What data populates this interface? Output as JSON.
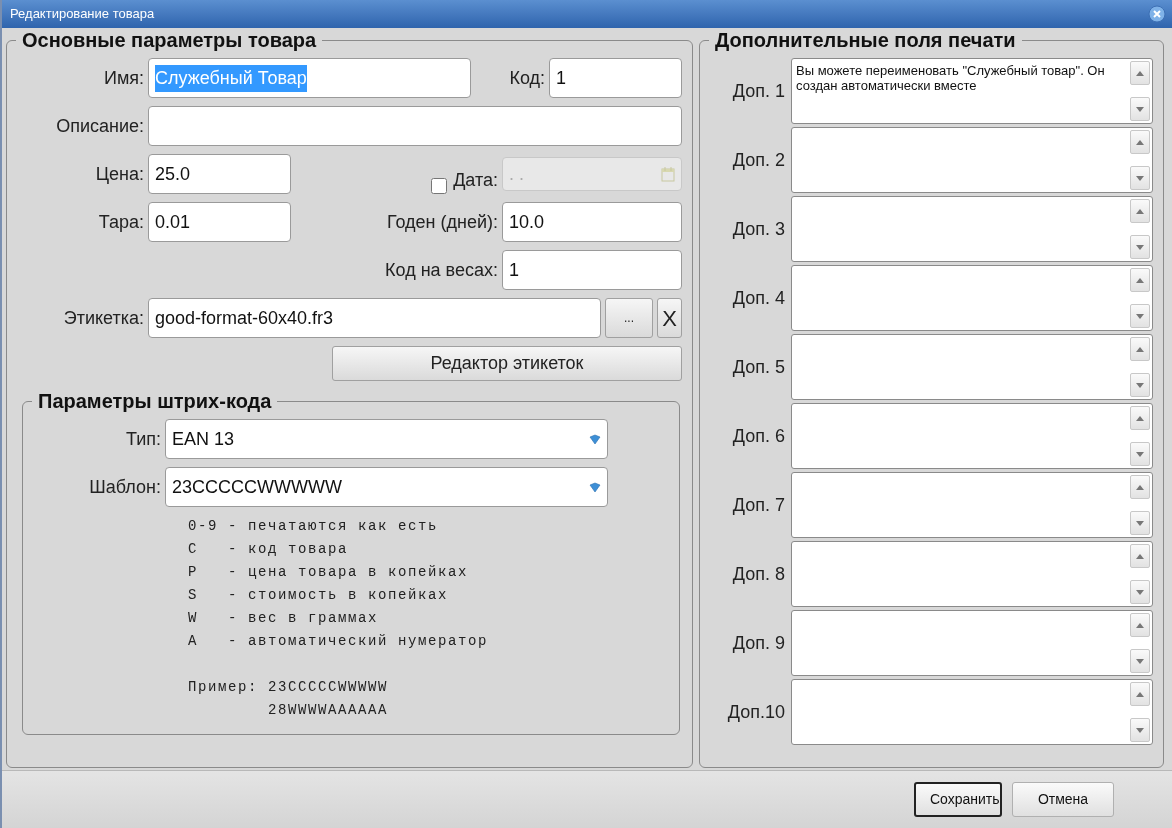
{
  "window": {
    "title": "Редактирование товара"
  },
  "main_group": {
    "title": "Основные параметры товара",
    "name": {
      "label": "Имя:",
      "value": "Служебный Товар",
      "text_selected": true
    },
    "code": {
      "label": "Код:",
      "value": "1"
    },
    "description": {
      "label": "Описание:"
    },
    "price": {
      "label": "Цена:",
      "value": "25.0"
    },
    "date": {
      "label": "Дата:",
      "checked": false,
      "value": ". .",
      "disabled": true
    },
    "tare": {
      "label": "Тара:",
      "value": "0.01"
    },
    "shelf_life": {
      "label": "Годен (дней):",
      "value": "10.0"
    },
    "scale_code": {
      "label": "Код на весах:",
      "value": "1"
    },
    "label_file": {
      "label": "Этикетка:",
      "value": "good-format-60x40.fr3",
      "browse_button": "...",
      "clear_button": "X"
    },
    "label_editor_button": "Редактор этикеток"
  },
  "barcode_group": {
    "title": "Параметры штрих-кода",
    "type": {
      "label": "Тип:",
      "value": "EAN 13"
    },
    "template": {
      "label": "Шаблон:",
      "value": "23CCCCCWWWWW"
    },
    "help_lines": [
      "0-9 - печатаются как есть",
      "C   - код товара",
      "P   - цена товара в копейках",
      "S   - стоимость в копейках",
      "W   - вес в граммах",
      "A   - автоматический нумератор"
    ],
    "example": {
      "label": "Пример:",
      "values": [
        "23CCCCCWWWWW",
        "28WWWWAAAAAA"
      ]
    }
  },
  "extra_group": {
    "title": "Дополнительные поля печати",
    "fields": [
      {
        "label": "Доп. 1",
        "value": "Вы можете переименовать \"Служебный товар\". Он создан автоматически вместе"
      },
      {
        "label": "Доп. 2"
      },
      {
        "label": "Доп. 3"
      },
      {
        "label": "Доп. 4"
      },
      {
        "label": "Доп. 5"
      },
      {
        "label": "Доп. 6"
      },
      {
        "label": "Доп. 7"
      },
      {
        "label": "Доп. 8"
      },
      {
        "label": "Доп. 9"
      },
      {
        "label": "Доп.10"
      }
    ]
  },
  "buttons": [
    {
      "label": "Сохранить",
      "default": true
    },
    {
      "label": "Отмена",
      "default": false
    }
  ]
}
